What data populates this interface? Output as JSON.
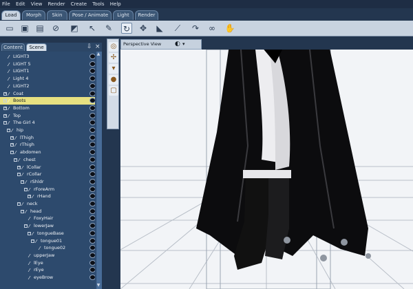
{
  "menu": [
    "File",
    "Edit",
    "View",
    "Render",
    "Create",
    "Tools",
    "Help"
  ],
  "room_tabs": [
    "Load",
    "Morph",
    "Skin",
    "Pose / Animate",
    "Light",
    "Render"
  ],
  "toolbar_icons": [
    "new-icon",
    "open-icon",
    "save-icon",
    "close-icon",
    "scene-icon",
    "select-icon",
    "rotate-icon",
    "move-icon",
    "scale-icon",
    "bend-icon",
    "twist-icon",
    "taper-icon",
    "morph-icon"
  ],
  "panel": {
    "tabs": [
      "Content",
      "Scene"
    ],
    "rows": [
      {
        "label": "LIGHT3",
        "level": 0,
        "expand": ""
      },
      {
        "label": "LIGHT 5",
        "level": 0,
        "expand": ""
      },
      {
        "label": "LIGHT1",
        "level": 0,
        "expand": ""
      },
      {
        "label": "Light 4",
        "level": 0,
        "expand": ""
      },
      {
        "label": "LIGHT2",
        "level": 0,
        "expand": ""
      },
      {
        "label": "Coat",
        "level": 0,
        "expand": "+"
      },
      {
        "label": "Boots",
        "level": 0,
        "expand": "+",
        "selected": true
      },
      {
        "label": "Bottom",
        "level": 0,
        "expand": "+"
      },
      {
        "label": "Top",
        "level": 0,
        "expand": "+"
      },
      {
        "label": "The Girl 4",
        "level": 0,
        "expand": "−"
      },
      {
        "label": "hip",
        "level": 1,
        "expand": "−"
      },
      {
        "label": "lThigh",
        "level": 2,
        "expand": "+"
      },
      {
        "label": "rThigh",
        "level": 2,
        "expand": "+"
      },
      {
        "label": "abdomen",
        "level": 2,
        "expand": "−"
      },
      {
        "label": "chest",
        "level": 3,
        "expand": "−"
      },
      {
        "label": "lCollar",
        "level": 4,
        "expand": "+"
      },
      {
        "label": "rCollar",
        "level": 4,
        "expand": "−"
      },
      {
        "label": "rShldr",
        "level": 5,
        "expand": "−"
      },
      {
        "label": "rForeArm",
        "level": 6,
        "expand": "−"
      },
      {
        "label": "rHand",
        "level": 7,
        "expand": "+"
      },
      {
        "label": "neck",
        "level": 4,
        "expand": "−"
      },
      {
        "label": "head",
        "level": 5,
        "expand": "−"
      },
      {
        "label": "FoxyHair",
        "level": 6,
        "expand": ""
      },
      {
        "label": "lowerJaw",
        "level": 6,
        "expand": "−"
      },
      {
        "label": "tongueBase",
        "level": 7,
        "expand": "−"
      },
      {
        "label": "tongue01",
        "level": 8,
        "expand": "−"
      },
      {
        "label": "tongue02",
        "level": 9,
        "expand": ""
      },
      {
        "label": "upperJaw",
        "level": 6,
        "expand": ""
      },
      {
        "label": "lEye",
        "level": 6,
        "expand": ""
      },
      {
        "label": "rEye",
        "level": 6,
        "expand": ""
      },
      {
        "label": "eyeBrow",
        "level": 6,
        "expand": ""
      }
    ]
  },
  "view_tools": [
    "rotate-view-icon",
    "pan-view-icon",
    "dolly-view-icon",
    "zoom-view-icon",
    "frame-view-icon"
  ],
  "viewport": {
    "title": "Perspective View",
    "icons": [
      "sphere-icon",
      "dropdown-arrow-icon"
    ]
  },
  "colors": {
    "selected_row": "#e7e181",
    "panel_bg": "#2d4a6d",
    "toolbar_bg": "#c8d3e0",
    "viewport_bg": "#f2f4f7"
  }
}
